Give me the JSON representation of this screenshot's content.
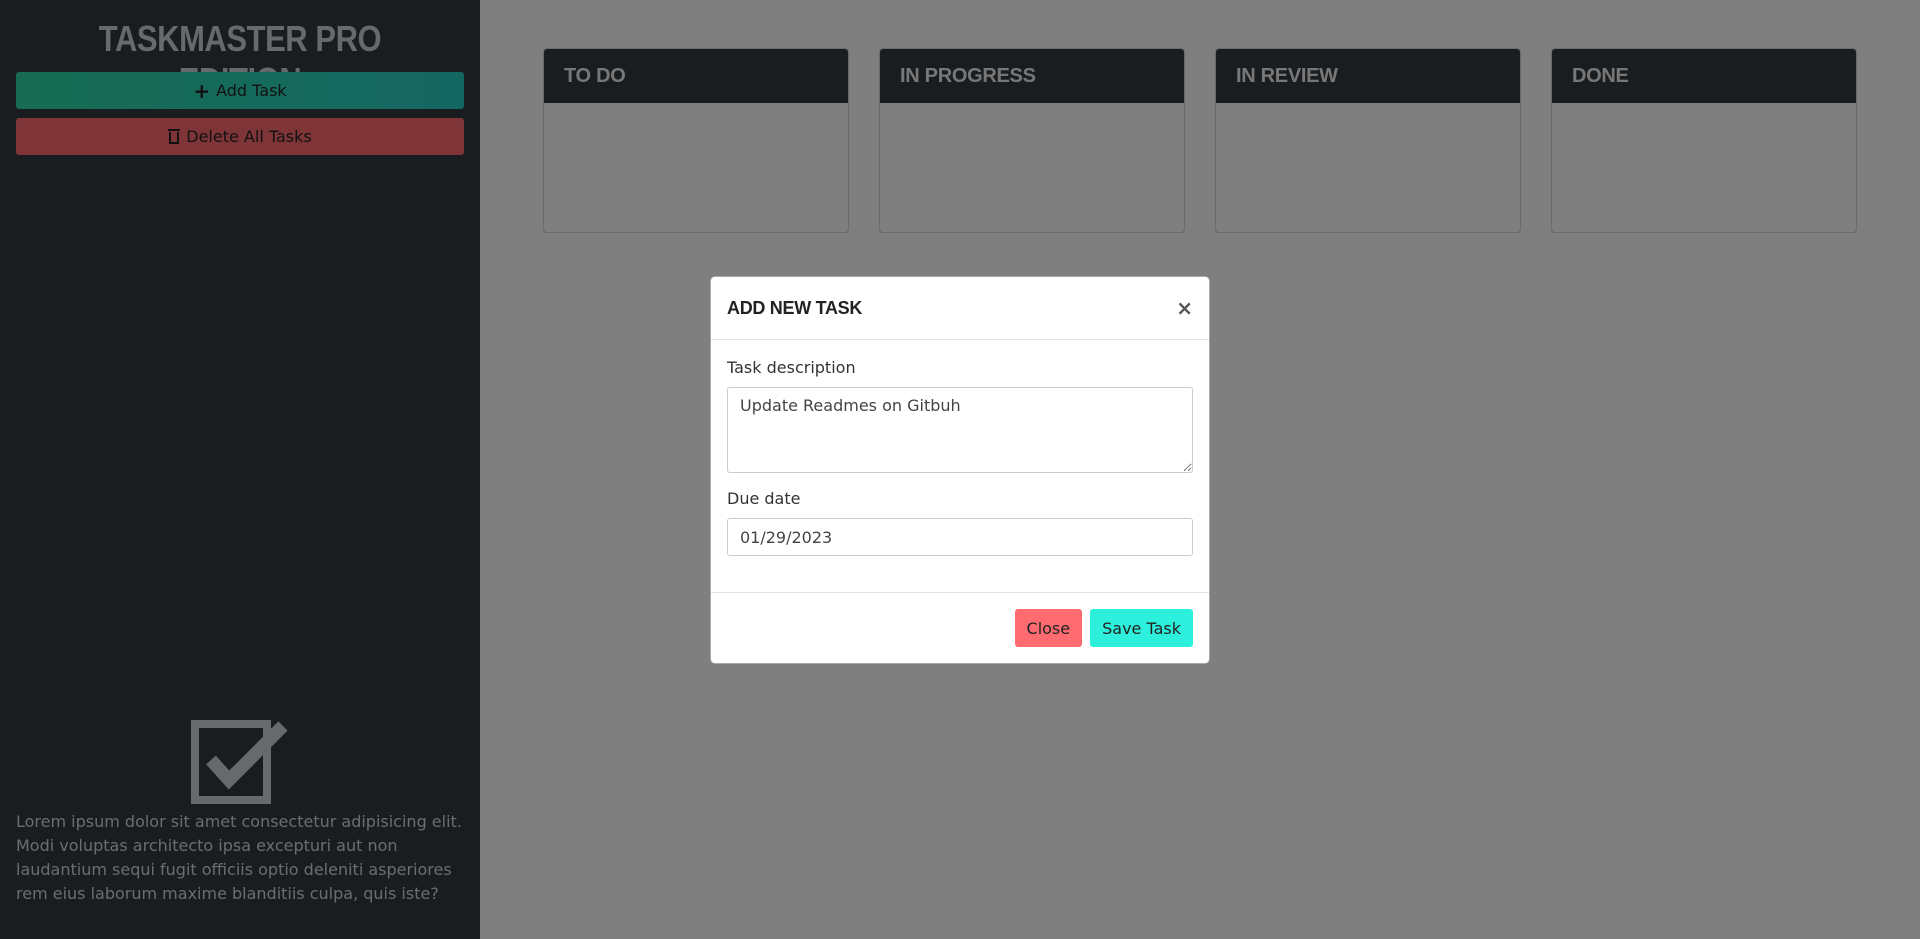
{
  "sidebar": {
    "brand": "TASKMASTER PRO EDITION",
    "add_task_label": "Add Task",
    "delete_all_label": "Delete All Tasks",
    "description": "Lorem ipsum dolor sit amet consectetur adipisicing elit. Modi voluptas architecto ipsa excepturi aut non laudantium sequi fugit officiis optio deleniti asperiores rem eius laborum maxime blanditiis culpa, quis iste?",
    "icons": {
      "add": "plus-icon",
      "delete": "trash-icon",
      "logo": "checkbox-icon"
    }
  },
  "board": {
    "columns": [
      {
        "title": "TO DO"
      },
      {
        "title": "IN PROGRESS"
      },
      {
        "title": "IN REVIEW"
      },
      {
        "title": "DONE"
      }
    ]
  },
  "modal": {
    "title": "ADD NEW TASK",
    "close_symbol": "×",
    "description_label": "Task description",
    "description_value": "Update Readmes on Gitbuh",
    "due_label": "Due date",
    "due_value": "01/29/2023",
    "close_button": "Close",
    "save_button": "Save Task"
  },
  "colors": {
    "sidebar_bg": "#343a40",
    "add_button": "#2fd9a6",
    "delete_button": "#ff6b70",
    "save_button": "#2df0dc",
    "close_button": "#ff6b70"
  }
}
